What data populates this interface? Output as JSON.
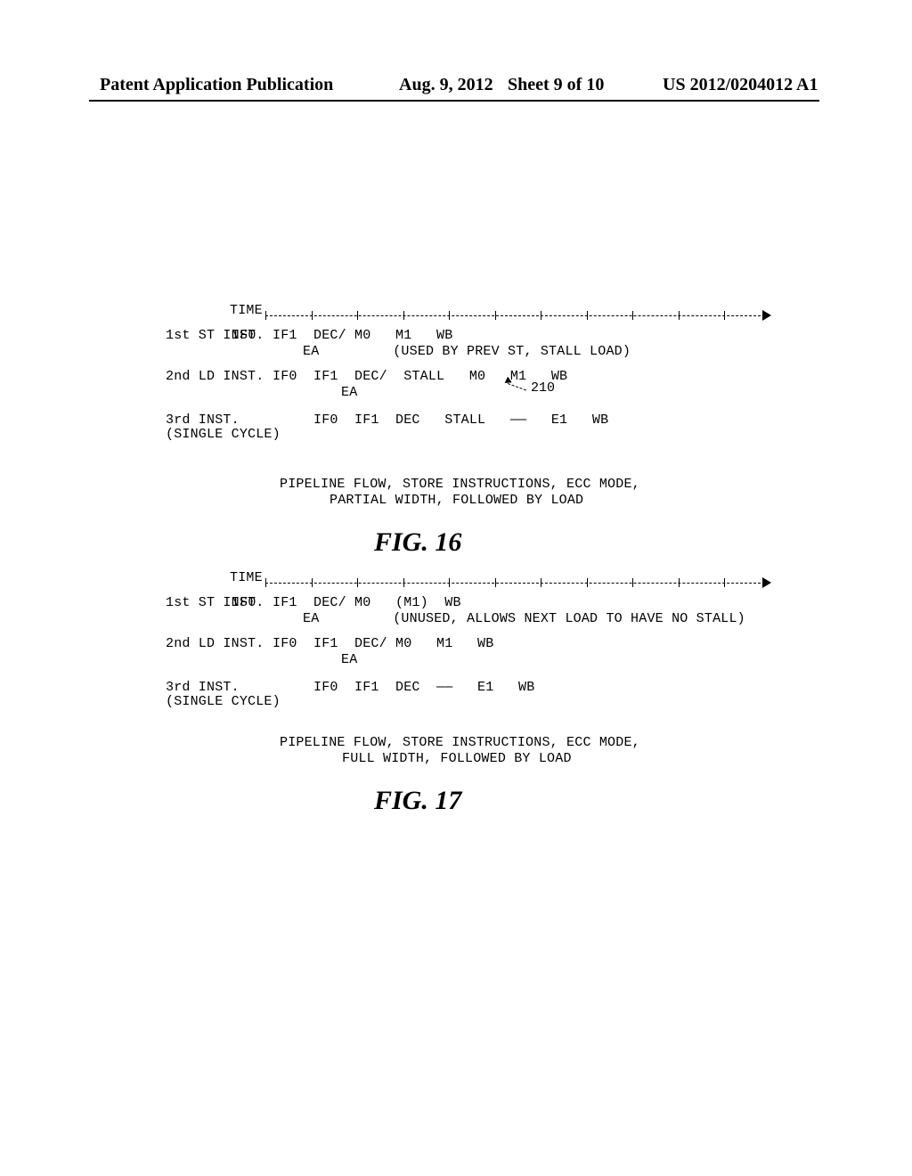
{
  "header": {
    "left": "Patent Application Publication",
    "date": "Aug. 9, 2012",
    "sheet": "Sheet 9 of 10",
    "pubno": "US 2012/0204012 A1"
  },
  "fig16": {
    "time_label": "TIME",
    "rows": {
      "r1_label": "1st ST INST.",
      "r1_stages": "IF0  IF1  DEC/ M0   M1   WB",
      "r1_sub": "EA         (USED BY PREV ST, STALL LOAD)",
      "r2_label": "2nd LD INST.",
      "r2_stages": "     IF0  IF1  DEC/  STALL   M0   M1   WB",
      "r2_sub": "EA",
      "r3_label": "3rd INST.",
      "r3_label2": "(SINGLE CYCLE)",
      "r3_stages": "          IF0  IF1  DEC   STALL   ——   E1   WB"
    },
    "callout_210": "210",
    "caption1": "PIPELINE FLOW, STORE INSTRUCTIONS, ECC MODE,",
    "caption2": "PARTIAL WIDTH, FOLLOWED BY LOAD",
    "label": "FIG.  16"
  },
  "fig17": {
    "time_label": "TIME",
    "rows": {
      "r1_label": "1st ST INST.",
      "r1_stages": "IF0  IF1  DEC/ M0   (M1)  WB",
      "r1_sub": "EA         (UNUSED, ALLOWS NEXT LOAD TO HAVE NO STALL)",
      "r2_label": "2nd LD INST.",
      "r2_stages": "     IF0  IF1  DEC/ M0   M1   WB",
      "r2_sub": "EA",
      "r3_label": "3rd INST.",
      "r3_label2": "(SINGLE CYCLE)",
      "r3_stages": "          IF0  IF1  DEC  ——   E1   WB"
    },
    "caption1": "PIPELINE FLOW, STORE INSTRUCTIONS, ECC MODE,",
    "caption2": "FULL WIDTH, FOLLOWED BY LOAD",
    "label": "FIG.  17"
  },
  "axis": {
    "tick_count": 12
  }
}
